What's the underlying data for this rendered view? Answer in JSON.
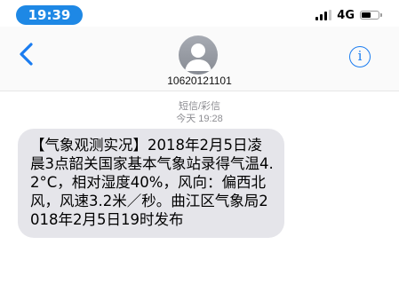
{
  "status_bar": {
    "time": "19:39",
    "network": "4G",
    "battery_level": 0.52,
    "accent_color": "#1E88E5"
  },
  "header": {
    "back_icon": "chevron-left-icon",
    "contact_number": "10620121101",
    "info_label": "i",
    "avatar_icon": "person-silhouette-icon",
    "accent_color": "#1A7CF0"
  },
  "conversation": {
    "message_type": "短信/彩信",
    "timestamp": "今天 19:28",
    "messages": [
      {
        "direction": "incoming",
        "text": "【气象观测实况】2018年2月5日凌晨3点韶关国家基本气象站录得气温4.2°C，相对湿度40%，风向：偏西北风，风速3.2米／秒。曲江区气象局2018年2月5日19时发布"
      }
    ]
  }
}
